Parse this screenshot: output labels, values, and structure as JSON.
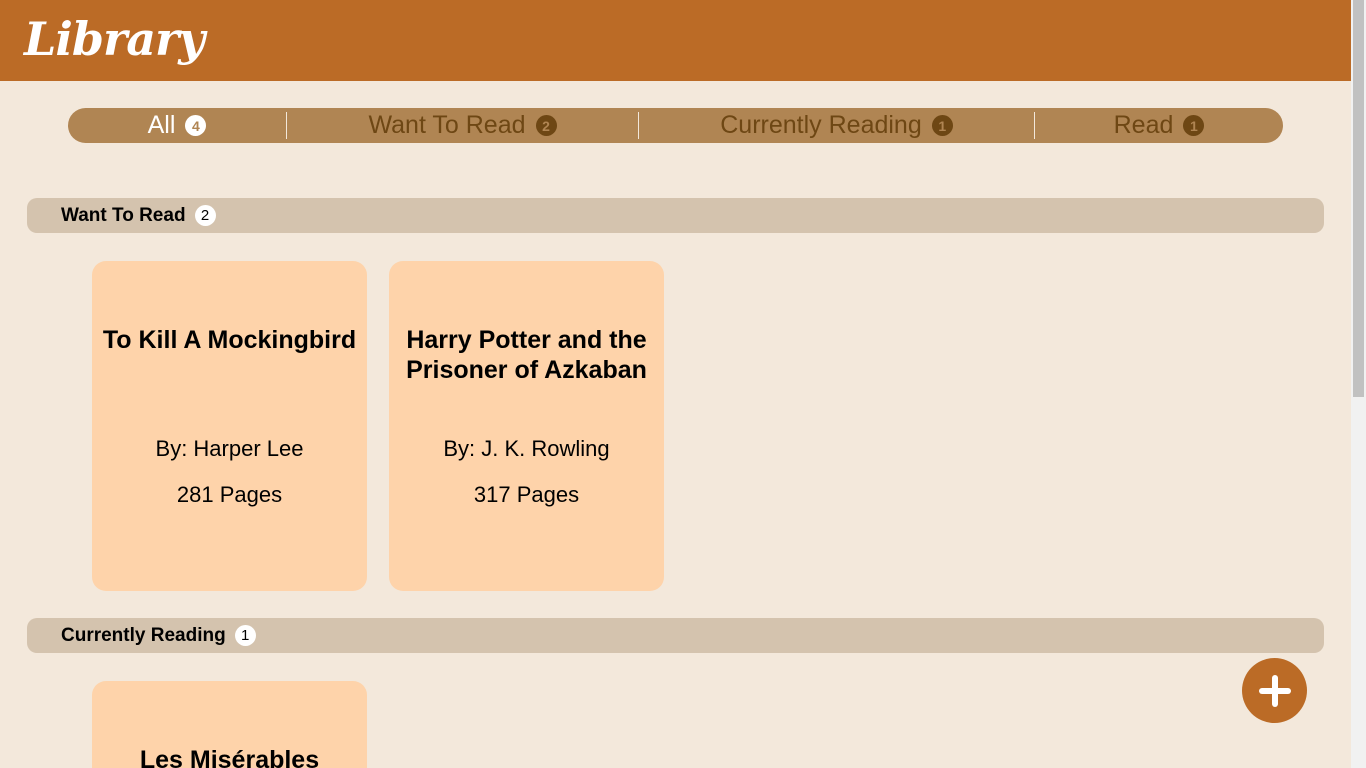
{
  "header": {
    "title": "Library"
  },
  "filters": [
    {
      "label": "All",
      "count": "4"
    },
    {
      "label": "Want To Read",
      "count": "2"
    },
    {
      "label": "Currently Reading",
      "count": "1"
    },
    {
      "label": "Read",
      "count": "1"
    }
  ],
  "sections": [
    {
      "title": "Want To Read",
      "count": "2",
      "books": [
        {
          "title": "To Kill A Mockingbird",
          "author": "By: Harper Lee",
          "pages": "281 Pages"
        },
        {
          "title": "Harry Potter and the Prisoner of Azkaban",
          "author": "By: J. K. Rowling",
          "pages": "317 Pages"
        }
      ]
    },
    {
      "title": "Currently Reading",
      "count": "1",
      "books": [
        {
          "title": "Les Misérables"
        }
      ]
    }
  ],
  "fab": {
    "icon": "plus-icon"
  },
  "colors": {
    "header": "#bb6b26",
    "background": "#f3e8db",
    "filter_bar": "#b08553",
    "section_bar": "#d4c3ae",
    "card": "#fed3aa"
  }
}
